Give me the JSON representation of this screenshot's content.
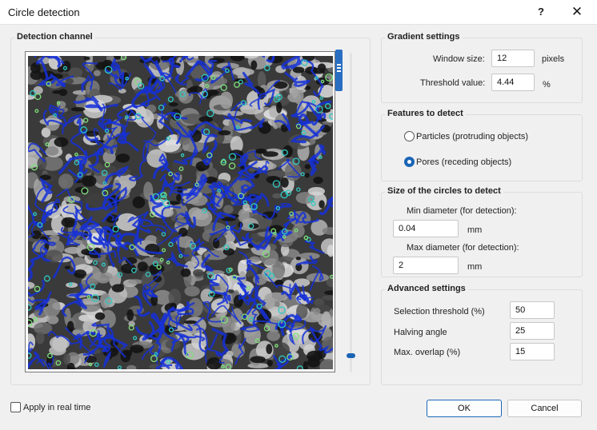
{
  "window": {
    "title": "Circle detection",
    "help_label": "?",
    "close_label": "✕"
  },
  "detection_channel": {
    "title": "Detection channel"
  },
  "gradient": {
    "title": "Gradient settings",
    "window_size_label": "Window size:",
    "window_size_value": "12",
    "window_size_unit": "pixels",
    "threshold_label": "Threshold value:",
    "threshold_value": "4.44",
    "threshold_unit": "%"
  },
  "features": {
    "title": "Features to detect",
    "option_particles": "Particles (protruding objects)",
    "option_pores": "Pores (receding objects)",
    "selected": "pores"
  },
  "circle_size": {
    "title": "Size of the circles to detect",
    "min_label": "Min diameter (for detection):",
    "min_value": "0.04",
    "min_unit": "mm",
    "max_label": "Max diameter (for detection):",
    "max_value": "2",
    "max_unit": "mm"
  },
  "advanced": {
    "title": "Advanced settings",
    "selection_threshold_label": "Selection threshold (%)",
    "selection_threshold_value": "50",
    "halving_angle_label": "Halving angle",
    "halving_angle_value": "25",
    "max_overlap_label": "Max. overlap (%)",
    "max_overlap_value": "15"
  },
  "apply_realtime": {
    "label": "Apply in real time",
    "checked": false
  },
  "buttons": {
    "ok": "OK",
    "cancel": "Cancel"
  },
  "colors": {
    "accent": "#1a64b5",
    "contour": "#1530d8",
    "marker": "#30c8c0"
  }
}
